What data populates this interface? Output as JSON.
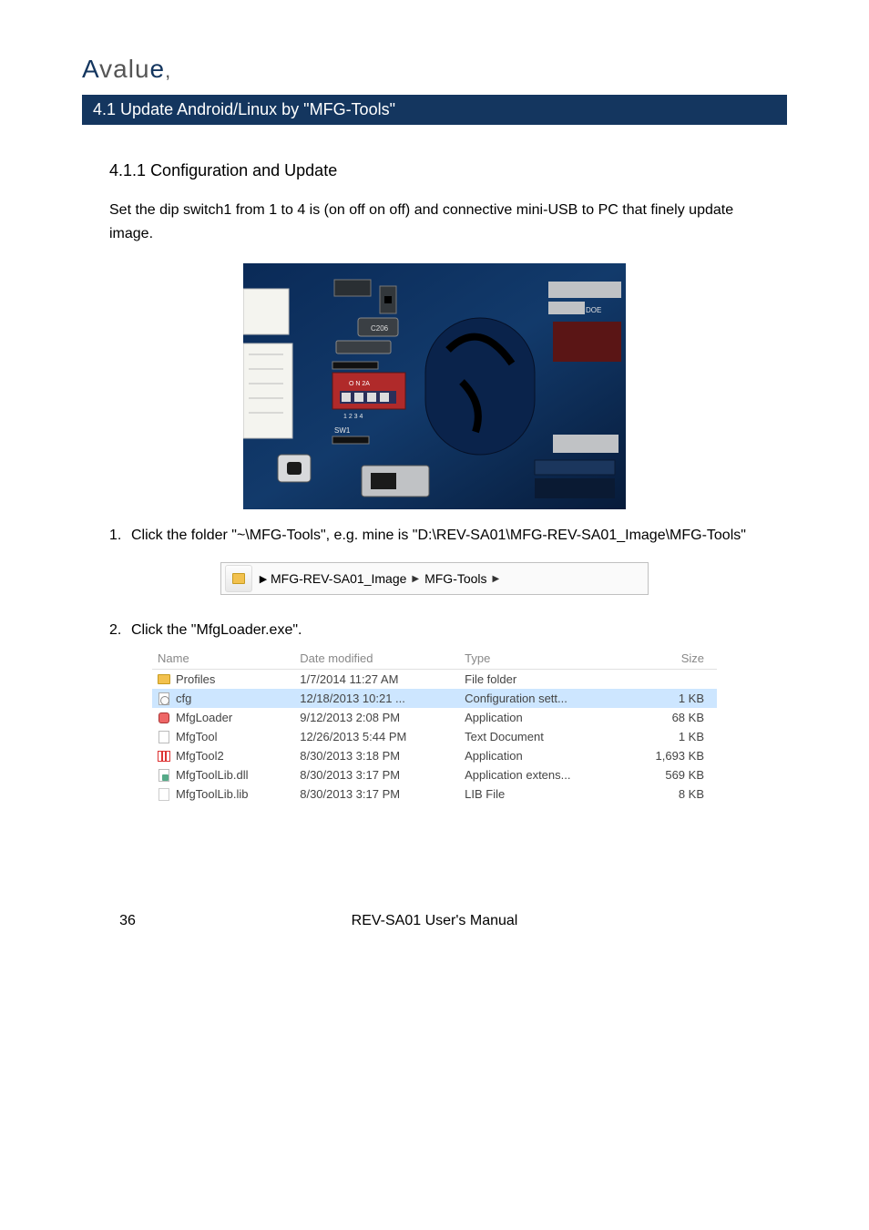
{
  "header": {
    "brand_full": "Avalue,",
    "brand_prefix": "A",
    "brand_rest": "valu",
    "brand_suffix": "e"
  },
  "blue_bar": {
    "num": "4.1",
    "title": "Update Android/Linux by \"MFG-Tools\""
  },
  "section": {
    "num": "4.1.1",
    "title": "Configuration and Update"
  },
  "body1": "Set the dip switch1 from 1 to 4 is (on off on off) and connective mini-USB to PC that finely update image.",
  "steps": {
    "s1": {
      "n": "1.",
      "text_a": "Click the folder \"~",
      "text_b": "\\MFG-Tools",
      "text_c": "\", e.g. mi",
      "text_d": "ne is \"D:\\REV-SA01\\MFG-REV-SA01_Image\\MFG-Tools\""
    },
    "s2": {
      "n": "2.",
      "text": "Click the \"",
      "text_b": "MfgLoader.exe",
      "text_c": "\"."
    }
  },
  "breadcrumb": {
    "a": "MFG-REV-SA01_Image",
    "b": "MFG-Tools"
  },
  "table": {
    "headers": {
      "name": "Name",
      "date": "Date modified",
      "type": "Type",
      "size": "Size"
    },
    "rows": [
      {
        "icon": "folder-ico",
        "name": "Profiles",
        "date": "1/7/2014 11:27 AM",
        "type": "File folder",
        "size": ""
      },
      {
        "icon": "cfg-ico",
        "name": "cfg",
        "date": "12/18/2013 10:21 ...",
        "type": "Configuration sett...",
        "size": "1 KB",
        "sel": true
      },
      {
        "icon": "app-red-ico",
        "name": "MfgLoader",
        "date": "9/12/2013 2:08 PM",
        "type": "Application",
        "size": "68 KB"
      },
      {
        "icon": "txt-ico",
        "name": "MfgTool",
        "date": "12/26/2013 5:44 PM",
        "type": "Text Document",
        "size": "1 KB"
      },
      {
        "icon": "app2-ico",
        "name": "MfgTool2",
        "date": "8/30/2013 3:18 PM",
        "type": "Application",
        "size": "1,693 KB"
      },
      {
        "icon": "dll-ico",
        "name": "MfgToolLib.dll",
        "date": "8/30/2013 3:17 PM",
        "type": "Application extens...",
        "size": "569 KB"
      },
      {
        "icon": "lib-ico",
        "name": "MfgToolLib.lib",
        "date": "8/30/2013 3:17 PM",
        "type": "LIB File",
        "size": "8 KB"
      }
    ]
  },
  "footer": {
    "page": "36",
    "text": "REV-SA01 User's Manual"
  }
}
